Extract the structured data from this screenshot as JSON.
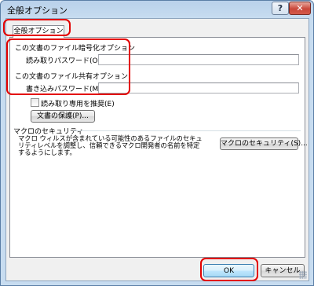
{
  "window": {
    "title": "全般オプション",
    "help_label": "?",
    "close_label": "✕"
  },
  "tab": {
    "label": "全般オプション"
  },
  "encryption": {
    "heading": "この文書のファイル暗号化オプション",
    "open_password_label": "読み取りパスワード(O):",
    "open_password_value": ""
  },
  "sharing": {
    "heading": "この文書のファイル共有オプション",
    "write_password_label": "書き込みパスワード(M):",
    "write_password_value": "",
    "readonly_recommended_label": "読み取り専用を推奨(E)",
    "readonly_recommended_checked": false,
    "protect_document_label": "文書の保護(P)..."
  },
  "macro": {
    "heading": "マクロのセキュリティ",
    "description": "マクロ ウィルスが含まれている可能性のあるファイルのセキュリティレベルを調整し、信頼できるマクロ開発者の名前を特定するようにします。",
    "security_button_label": "マクロのセキュリティ(S)..."
  },
  "footer": {
    "ok_label": "OK",
    "cancel_label": "キャンセル"
  },
  "colors": {
    "highlight": "#e30000"
  }
}
